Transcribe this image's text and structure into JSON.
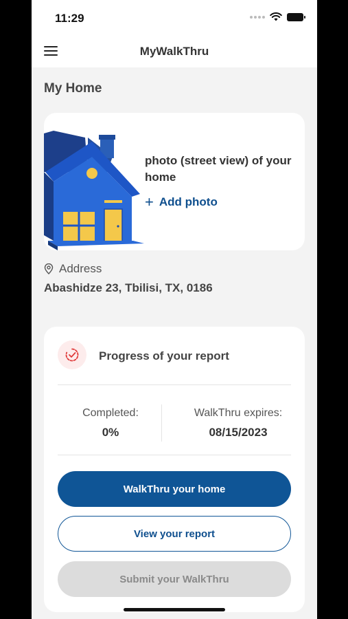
{
  "status_bar": {
    "time": "11:29"
  },
  "nav": {
    "title": "MyWalkThru"
  },
  "section": {
    "title": "My Home"
  },
  "photo_card": {
    "text": "photo (street view) of your home",
    "add_photo_label": "Add photo"
  },
  "address": {
    "label": "Address",
    "value": "Abashidze 23, Tbilisi, TX, 0186"
  },
  "progress": {
    "title": "Progress of your report",
    "completed_label": "Completed:",
    "completed_value": "0%",
    "expires_label": "WalkThru expires:",
    "expires_value": "08/15/2023"
  },
  "buttons": {
    "walkthru": "WalkThru your home",
    "view_report": "View your report",
    "submit": "Submit your WalkThru"
  },
  "colors": {
    "primary": "#0f5596",
    "background": "#f3f3f3",
    "disabled": "#dcdcdc",
    "progress_icon": "#e03a3a"
  }
}
